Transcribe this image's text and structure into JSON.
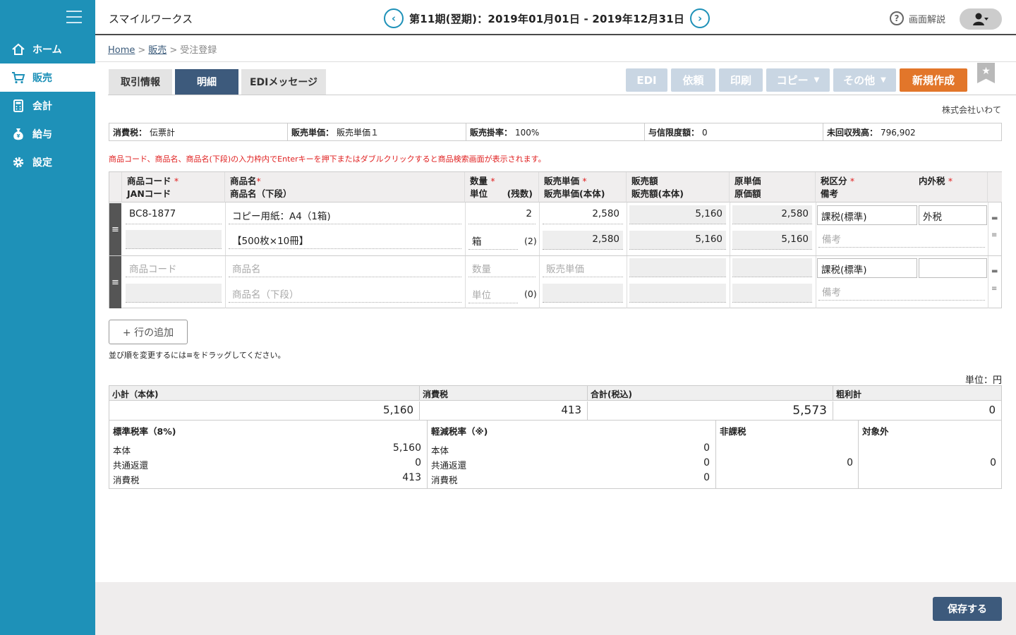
{
  "sidebar": {
    "items": [
      {
        "label": "ホーム",
        "icon": "home-icon"
      },
      {
        "label": "販売",
        "icon": "cart-icon",
        "active": true
      },
      {
        "label": "会計",
        "icon": "calculator-icon"
      },
      {
        "label": "給与",
        "icon": "money-bag-icon"
      },
      {
        "label": "設定",
        "icon": "gear-icon"
      }
    ]
  },
  "header": {
    "company": "スマイルワークス",
    "period": "第11期(翌期)：2019年01月01日 - 2019年12月31日",
    "prev": "‹",
    "next": "›",
    "help_label": "画面解説"
  },
  "breadcrumb": {
    "home": "Home",
    "sales": "販売",
    "current": "受注登録",
    "sep": ">"
  },
  "tabs": [
    "取引情報",
    "明細",
    "EDIメッセージ"
  ],
  "toolbar": {
    "edi": "EDI",
    "request": "依頼",
    "print": "印刷",
    "copy": "コピー",
    "other": "その他",
    "new": "新規作成"
  },
  "client_name": "株式会社いわて",
  "info": {
    "tax_label": "消費税：",
    "tax_value": "伝票計",
    "price_label": "販売単価：",
    "price_value": "販売単価１",
    "rate_label": "販売掛率：",
    "rate_value": "100%",
    "credit_label": "与信限度額：",
    "credit_value": "0",
    "ar_label": "未回収残高：",
    "ar_value": "796,902"
  },
  "notice": "商品コード、商品名、商品名(下段)の入力枠内でEnterキーを押下またはダブルクリックすると商品検索画面が表示されます。",
  "grid": {
    "headers": {
      "code": "商品コード",
      "jan": "JANコード",
      "name": "商品名",
      "name2": "商品名（下段）",
      "qty": "数量",
      "unit": "単位",
      "remain": "(残数)",
      "price": "販売単価",
      "price2": "販売単価(本体)",
      "amount": "販売額",
      "amount2": "販売額(本体)",
      "cost": "原単価",
      "cost2": "原価額",
      "taxcat": "税区分",
      "memo": "備考",
      "taxinc": "内外税",
      "req": "*"
    },
    "row1": {
      "code": "BC8-1877",
      "name": "コピー用紙：A4（1箱)",
      "name2": "【500枚×10冊】",
      "qty": "2",
      "unit": "箱",
      "remain": "(2)",
      "price": "2,580",
      "price2": "2,580",
      "amount": "5,160",
      "amount2": "5,160",
      "cost": "2,580",
      "cost2": "5,160",
      "taxcat": "課税(標準)",
      "taxinc": "外税",
      "memo_ph": "備考"
    },
    "row2": {
      "code_ph": "商品コード",
      "name_ph": "商品名",
      "name2_ph": "商品名（下段）",
      "qty_ph": "数量",
      "unit_ph": "単位",
      "remain": "(0)",
      "price_ph": "販売単価",
      "taxcat": "課税(標準)",
      "memo_ph": "備考"
    },
    "handle": "≡",
    "comment_icon": "▬",
    "list_icon": "≡"
  },
  "add_row": "+ 行の追加",
  "drag_note": "並び順を変更するには≡をドラッグしてください。",
  "unit_label": "単位：円",
  "summary": {
    "subtotal_label": "小計（本体)",
    "subtotal": "5,160",
    "tax_label": "消費税",
    "tax": "413",
    "total_label": "合計(税込)",
    "total": "5,573",
    "profit_label": "粗利計",
    "profit": "0",
    "std": {
      "label": "標準税率（8%)",
      "body_label": "本体",
      "body": "5,160",
      "rebate_label": "共通返還",
      "rebate": "0",
      "tax_label": "消費税",
      "tax": "413"
    },
    "reduced": {
      "label": "軽減税率（※)",
      "body_label": "本体",
      "body": "0",
      "rebate_label": "共通返還",
      "rebate": "0",
      "tax_label": "消費税",
      "tax": "0"
    },
    "nontax": {
      "label": "非課税",
      "value": "0"
    },
    "exempt": {
      "label": "対象外",
      "value": "0"
    }
  },
  "save": "保存する"
}
